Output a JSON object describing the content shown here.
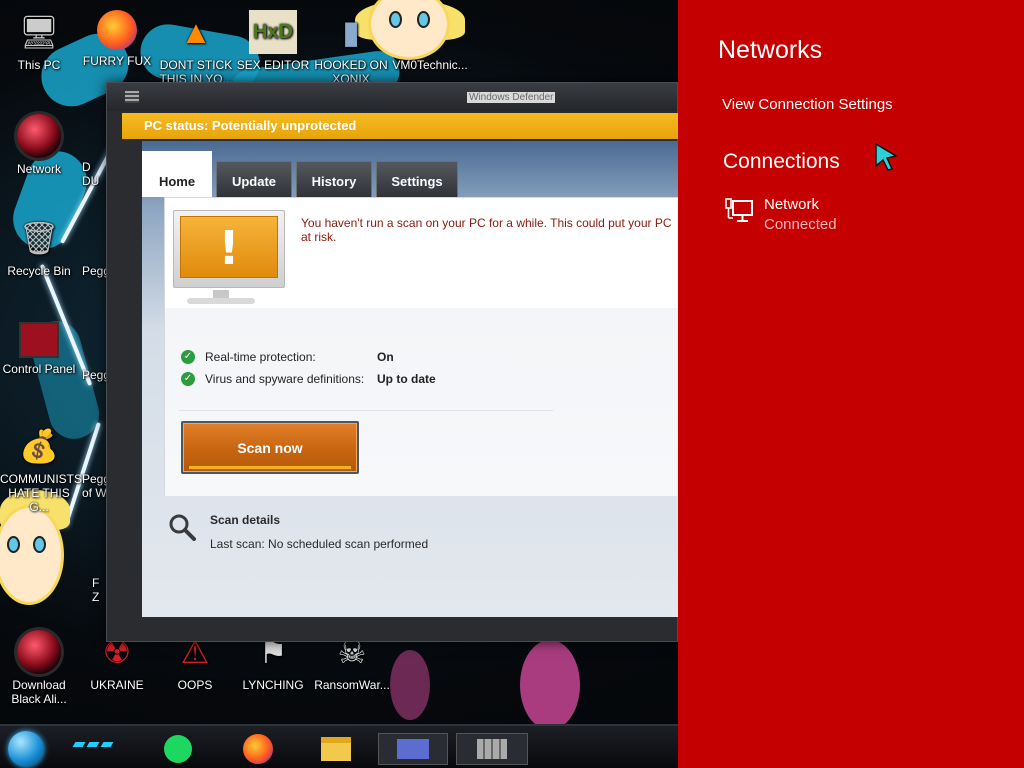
{
  "desktop": {
    "icons": [
      {
        "label": "This PC",
        "icon": "computer-icon"
      },
      {
        "label": "FURRY FUX",
        "icon": "firefox-icon"
      },
      {
        "label": "DONT STICK THIS IN YO...",
        "icon": "vlc-cone-icon"
      },
      {
        "label": "SEX EDITOR",
        "icon": "hex-editor-icon"
      },
      {
        "label": "HOOKED ON XONIX",
        "icon": "game-icon"
      },
      {
        "label": "VM0Technic...",
        "icon": "cartoon-icon"
      },
      {
        "label": "Network",
        "icon": "network-orb-icon"
      },
      {
        "label": "Recycle Bin",
        "icon": "recycle-bin-icon"
      },
      {
        "label": "Control Panel",
        "icon": "control-panel-icon"
      },
      {
        "label": "COMMUNISTS HATE THIS G...",
        "icon": "money-bag-icon"
      },
      {
        "label": "Download Black Ali...",
        "icon": "orb-icon"
      },
      {
        "label": "UKRAINE",
        "icon": "radiation-icon"
      },
      {
        "label": "OOPS",
        "icon": "warning-icon"
      },
      {
        "label": "LYNCHING",
        "icon": "flag-icon"
      },
      {
        "label": "RansomWar...",
        "icon": "skull-icon"
      }
    ],
    "partial_labels": [
      "D",
      "DU",
      "Pegg",
      "Pegg",
      "Pegg",
      "of W",
      "F",
      "Z"
    ]
  },
  "taskbar": {
    "items": [
      "start-orb-icon",
      "spotify-icon",
      "firefox-icon",
      "file-explorer-icon",
      "window-thumbnail-icon",
      "window-thumbnail-icon"
    ]
  },
  "defender": {
    "window_title": "Windows Defender",
    "status": "PC status: Potentially unprotected",
    "tabs": [
      {
        "label": "Home",
        "active": true
      },
      {
        "label": "Update",
        "active": false
      },
      {
        "label": "History",
        "active": false
      },
      {
        "label": "Settings",
        "active": false
      }
    ],
    "warning": "You haven't run a scan on your PC for a while. This could put your PC at risk.",
    "protection": [
      {
        "label": "Real-time protection:",
        "value": "On"
      },
      {
        "label": "Virus and spyware definitions:",
        "value": "Up to date"
      }
    ],
    "scan_button": "Scan now",
    "scan_details": {
      "title": "Scan details",
      "last_scan_label": "Last scan:",
      "last_scan_value": "No scheduled scan performed"
    },
    "colors": {
      "status_bar": "#f2b41b",
      "scan_button": "#c86510",
      "warning_text": "#8a1a0e"
    }
  },
  "networks_flyout": {
    "title": "Networks",
    "view_settings": "View Connection Settings",
    "connections_heading": "Connections",
    "connection": {
      "name": "Network",
      "status": "Connected"
    },
    "background_color": "#c40000"
  }
}
